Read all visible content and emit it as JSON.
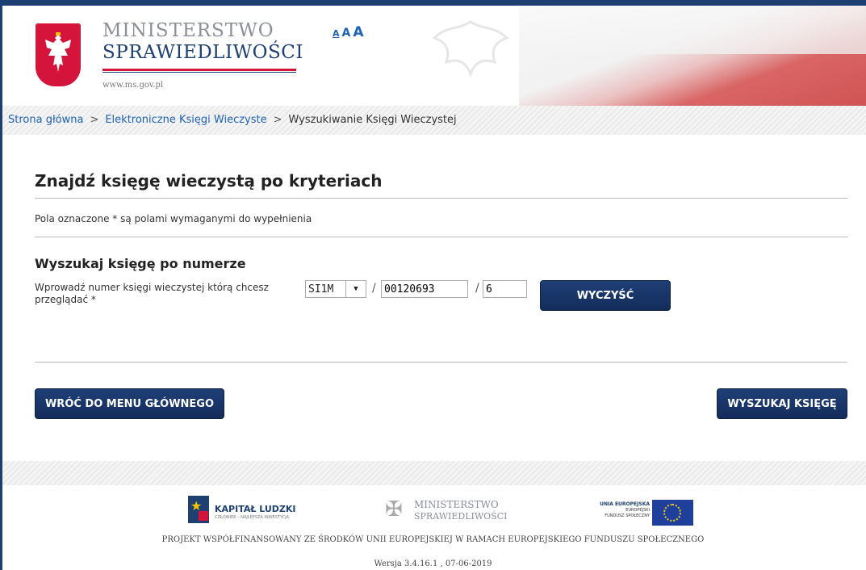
{
  "header": {
    "ministry_line1": "MINISTERSTWO",
    "ministry_line2": "SPRAWIEDLIWOŚCI",
    "url": "www.ms.gov.pl",
    "font_size_options": [
      "A",
      "A",
      "A"
    ]
  },
  "breadcrumb": {
    "items": [
      "Strona główna",
      "Elektroniczne Księgi Wieczyste",
      "Wyszukiwanie Księgi Wieczystej"
    ],
    "separator": ">"
  },
  "main": {
    "title": "Znajdź księgę wieczystą po kryteriach",
    "required_note": "Pola oznaczone * są polami wymaganymi do wypełnienia",
    "section_title": "Wyszukaj księgę po numerze",
    "field_label": "Wprowadź numer księgi wieczystej którą chcesz przeglądać *",
    "court_code": "SI1M",
    "separator": "/",
    "book_number": "00120693",
    "check_digit": "6",
    "clear_button": "WYCZYŚĆ",
    "back_button": "WRÓĆ DO MENU GŁÓWNEGO",
    "search_button": "WYSZUKAJ KSIĘGĘ"
  },
  "footer": {
    "kl_title": "KAPITAŁ LUDZKI",
    "kl_subtitle": "CZŁOWIEK – NAJLEPSZA INWESTYCJA",
    "ms_line1": "MINISTERSTWO",
    "ms_line2": "SPRAWIEDLIWOŚCI",
    "ue_title": "UNIA EUROPEJSKA",
    "ue_sub1": "EUROPEJSKI",
    "ue_sub2": "FUNDUSZ SPOŁECZNY",
    "project_text": "PROJEKT WSPÓŁFINANSOWANY ZE ŚRODKÓW UNII EUROPEJSKIEJ W RAMACH EUROPEJSKIEGO FUNDUSZU SPOŁECZNEGO",
    "version": "Wersja 3.4.16.1 , 07-06-2019"
  },
  "colors": {
    "brand_navy": "#1e3f72",
    "brand_red": "#d4143a",
    "link_blue": "#1e63b5"
  }
}
